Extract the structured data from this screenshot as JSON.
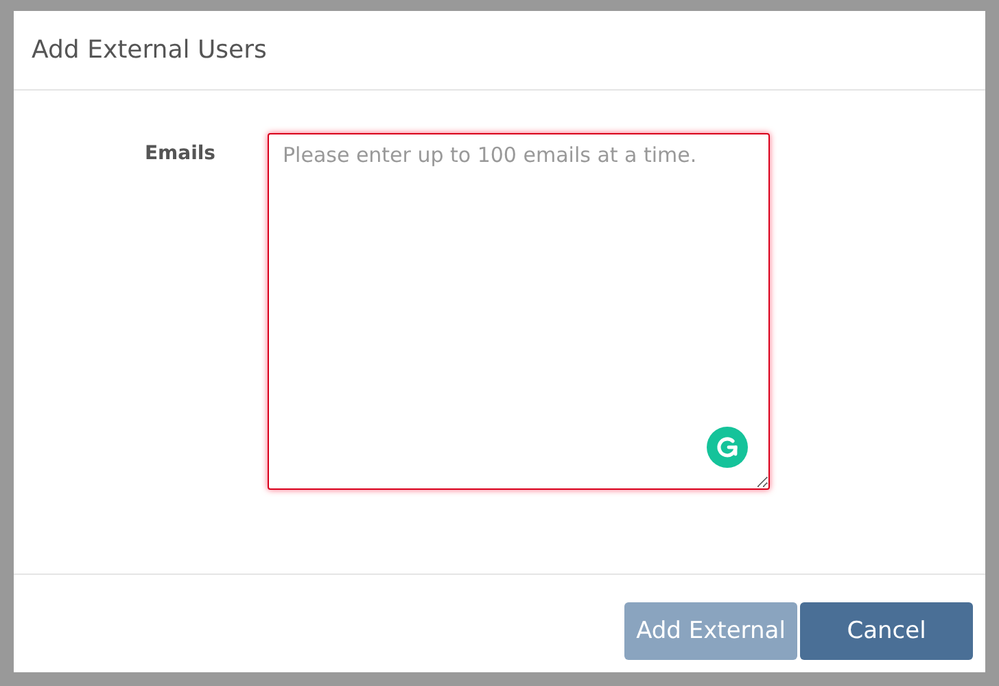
{
  "dialog": {
    "title": "Add External Users"
  },
  "form": {
    "label": "Emails",
    "field": {
      "placeholder": "Please enter up to 100 emails at a time.",
      "invalid": true
    }
  },
  "buttons": [
    {
      "label": "Add External",
      "kind": "primary",
      "disabled": true
    },
    {
      "label": "Cancel",
      "kind": "primary",
      "disabled": false
    }
  ]
}
